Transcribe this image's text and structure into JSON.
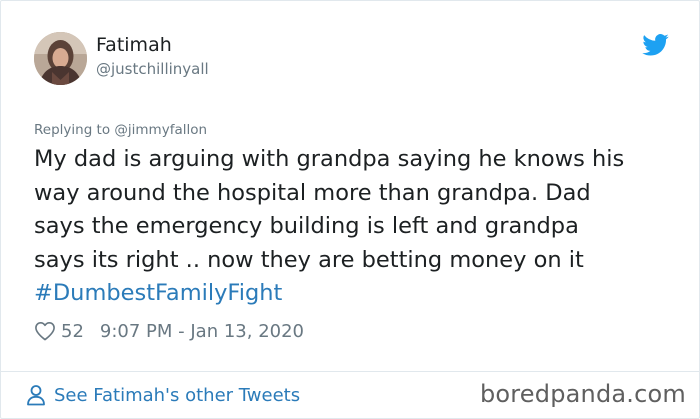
{
  "author": {
    "display_name": "Fatimah",
    "handle": "@justchillinyall"
  },
  "icons": {
    "avatar": "profile-photo",
    "brand": "twitter-bird-icon",
    "like": "heart-outline-icon",
    "see_more": "person-outline-icon"
  },
  "tweet": {
    "reply_to": "Replying to @jimmyfallon",
    "text_lines": [
      "My dad is arguing with grandpa saying he knows his",
      "way around the hospital more than grandpa. Dad",
      "says the emergency building is left and grandpa",
      "says its right .. now they are betting money on it"
    ],
    "hashtag": "#DumbestFamilyFight",
    "likes": "52",
    "timestamp": "9:07 PM - Jan 13, 2020"
  },
  "footer": {
    "see_more_label": "See Fatimah's other Tweets",
    "watermark": "boredpanda.com"
  },
  "colors": {
    "twitter_blue": "#1da1f2",
    "link_blue": "#2b7bb9",
    "muted_gray": "#697882",
    "text": "#1c2022",
    "border": "#e1e8ed"
  }
}
